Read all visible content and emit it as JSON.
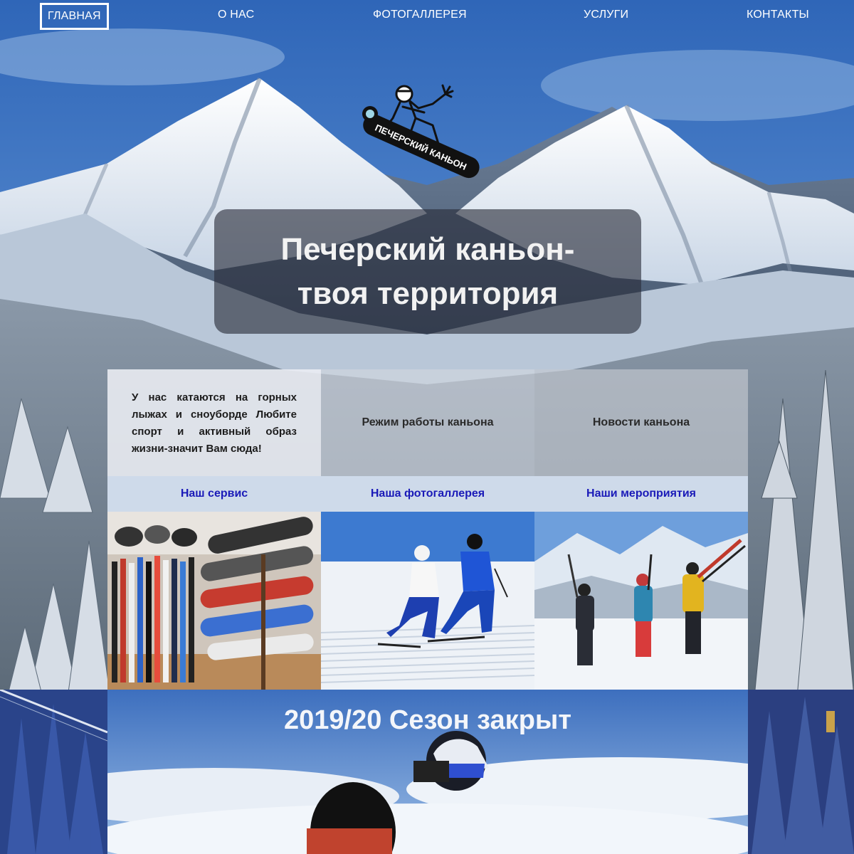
{
  "nav": {
    "items": [
      {
        "label": "ГЛАВНАЯ",
        "active": true
      },
      {
        "label": "О НАС",
        "active": false
      },
      {
        "label": "ФОТОГАЛЛЕРЕЯ",
        "active": false
      },
      {
        "label": "УСЛУГИ",
        "active": false
      },
      {
        "label": "КОНТАКТЫ",
        "active": false
      }
    ]
  },
  "logo": {
    "icon": "snowboarder-logo-icon",
    "text": "ПЕЧЕРСКИЙ КАНЬОН"
  },
  "hero": {
    "title": "Печерский каньон-твоя территория"
  },
  "intro": {
    "text": "У нас катаются на горных лыжах и сноуборде Любите спорт и активный образ жизни-значит Вам сюда!"
  },
  "info": {
    "hours": "Режим работы каньона",
    "news": "Новости каньона"
  },
  "links": {
    "service": "Наш сервис",
    "gallery": "Наша фотогаллерея",
    "events": "Наши мероприятия"
  },
  "season": {
    "title": "2019/20 Сезон закрыт"
  },
  "colors": {
    "link": "#1a1ab8",
    "nav_text": "#ffffff",
    "sky": "#3f78c4"
  }
}
